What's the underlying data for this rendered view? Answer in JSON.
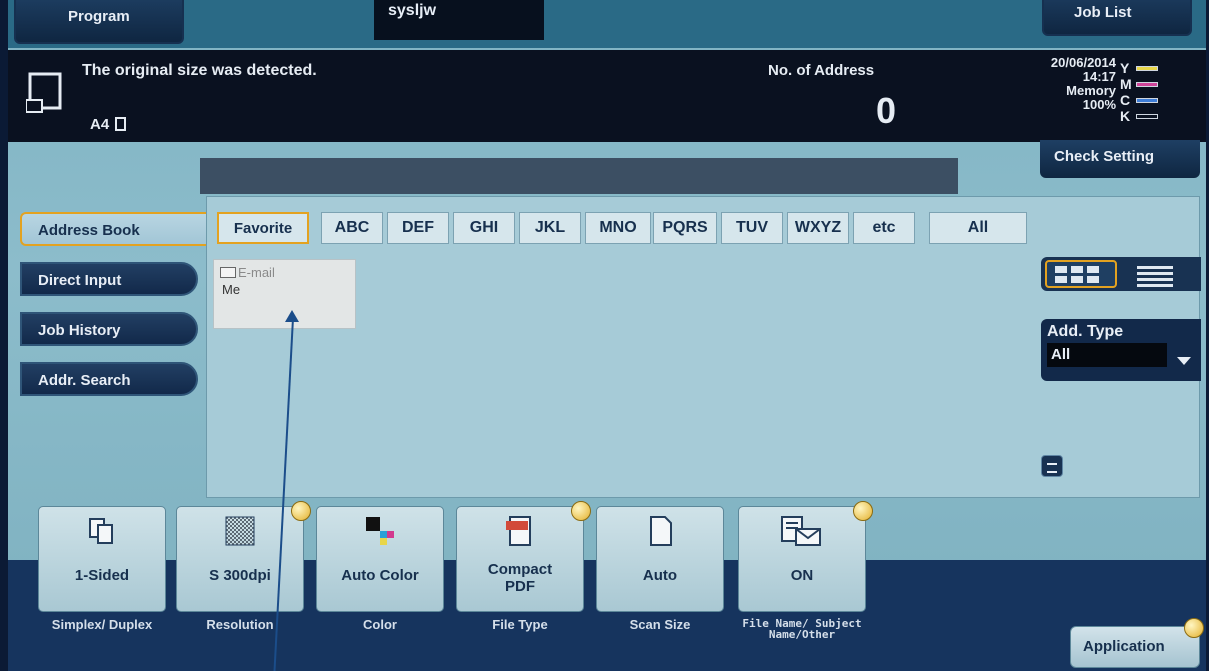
{
  "header": {
    "program_label": "Program",
    "user_name": "sysljw",
    "job_list_label": "Job List"
  },
  "message_bar": {
    "message": "The original size was detected.",
    "paper_size": "A4",
    "address_label": "No. of Address",
    "address_count": "0",
    "date": "20/06/2014",
    "time": "14:17",
    "memory_label": "Memory",
    "memory_value": "100%",
    "inks": [
      {
        "letter": "Y",
        "color": "#e8d64a"
      },
      {
        "letter": "M",
        "color": "#d0459a"
      },
      {
        "letter": "C",
        "color": "#3f7ed8"
      },
      {
        "letter": "K",
        "color": "#0a1120"
      }
    ]
  },
  "check_setting_label": "Check Setting",
  "nav": {
    "items": [
      {
        "label": "Address Book",
        "active": true
      },
      {
        "label": "Direct Input"
      },
      {
        "label": "Job History"
      },
      {
        "label": "Addr. Search"
      }
    ]
  },
  "tabs": [
    "Favorite",
    "ABC",
    "DEF",
    "GHI",
    "JKL",
    "MNO",
    "PQRS",
    "TUV",
    "WXYZ",
    "etc",
    "All"
  ],
  "address_entries": [
    {
      "type": "E-mail",
      "name": "Me"
    }
  ],
  "add_type": {
    "label": "Add. Type",
    "value": "All"
  },
  "settings": [
    {
      "value": "1-Sided",
      "label": "Simplex/ Duplex",
      "icon": "simplex-icon"
    },
    {
      "value": "S 300dpi",
      "label": "Resolution",
      "icon": "resolution-icon"
    },
    {
      "value": "Auto Color",
      "label": "Color",
      "icon": "color-icon"
    },
    {
      "value": "Compact PDF",
      "label": "File Type",
      "icon": "pdf-icon"
    },
    {
      "value": "Auto",
      "label": "Scan Size",
      "icon": "page-icon"
    },
    {
      "value": "ON",
      "label": "File Name/ Subject Name/Other",
      "icon": "email-doc-icon"
    }
  ],
  "application_label": "Application",
  "colors": {
    "accent": "#e3a220",
    "panel": "#a6cbd7",
    "dark_button": "#12294a"
  }
}
